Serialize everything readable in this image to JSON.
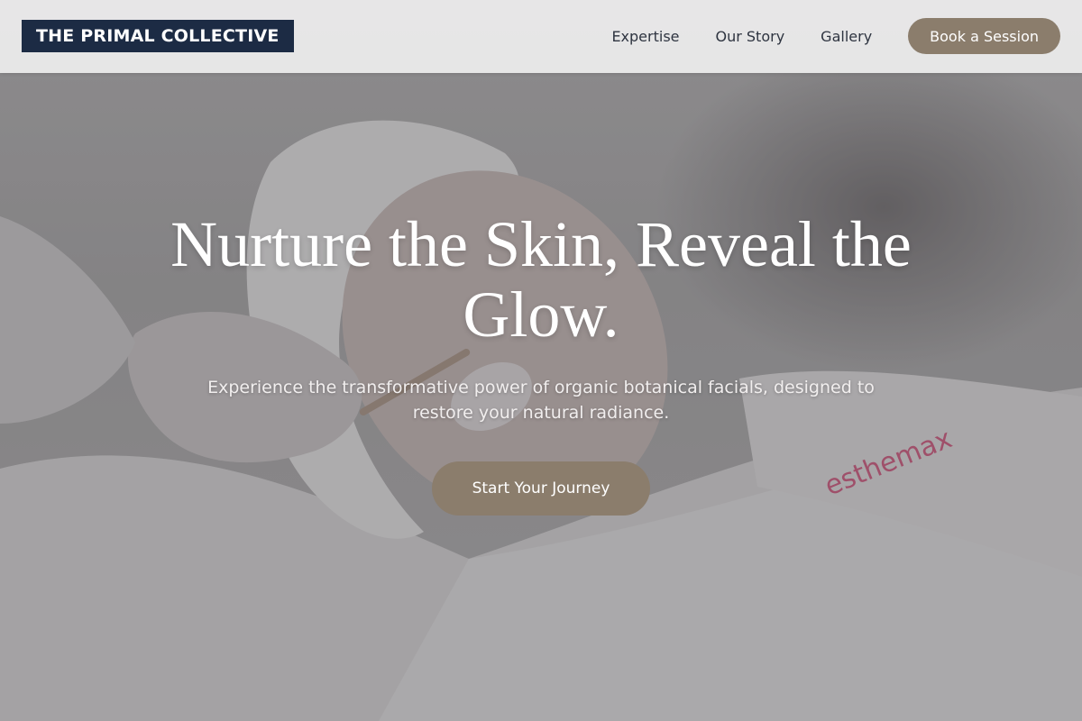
{
  "header": {
    "logo_text": "THE PRIMAL COLLECTIVE",
    "nav": [
      {
        "label": "Expertise"
      },
      {
        "label": "Our Story"
      },
      {
        "label": "Gallery"
      }
    ],
    "cta_label": "Book a Session"
  },
  "hero": {
    "title": "Nurture the Skin, Reveal the Glow.",
    "subtitle": "Experience the transformative power of organic botanical facials, designed to restore your natural radiance.",
    "cta_label": "Start Your Journey",
    "image_text": "esthemax"
  },
  "colors": {
    "logo_bg": "#1c2b44",
    "accent": "#8b7d6c",
    "header_bg": "#eaeaea",
    "nav_text": "#2e3440"
  }
}
